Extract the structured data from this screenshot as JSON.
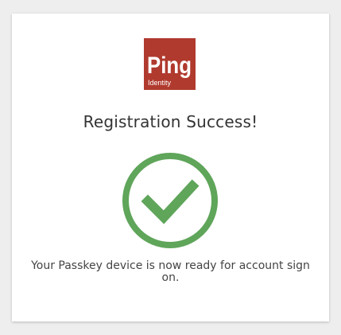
{
  "logo": {
    "brand_text": "Ping",
    "sub_text": "Identity",
    "background_color": "#b03a2e"
  },
  "heading": "Registration Success!",
  "status_icon": {
    "name": "check-circle-icon",
    "color": "#5fa55a"
  },
  "message": "Your Passkey device is now ready for account sign on."
}
